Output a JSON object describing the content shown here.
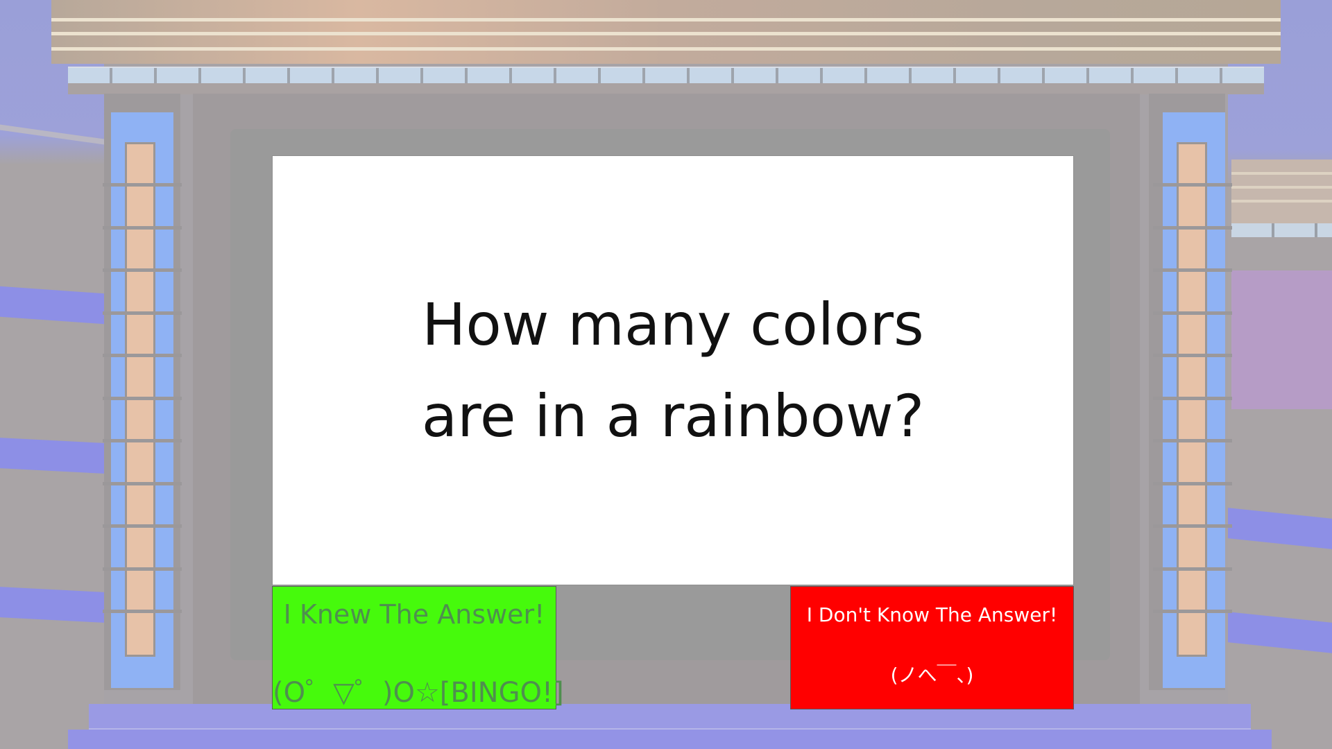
{
  "question": {
    "text": "How many colors\nare in a rainbow?"
  },
  "buttons": {
    "knew": {
      "label": "I Knew The Answer!",
      "emoticon": "(O゜▽゜)O☆[BINGO!]",
      "color": "#46fa0c"
    },
    "dont_know": {
      "label": "I Don't Know The Answer!",
      "emoticon": "(ノへ￣、)",
      "color": "#ff0000"
    }
  },
  "theme": {
    "stage_blue": "#8fb2f4",
    "stage_purple": "#9a9ae4",
    "header_tan": "#d9b8a1",
    "board_gray": "#9a9a9a"
  }
}
